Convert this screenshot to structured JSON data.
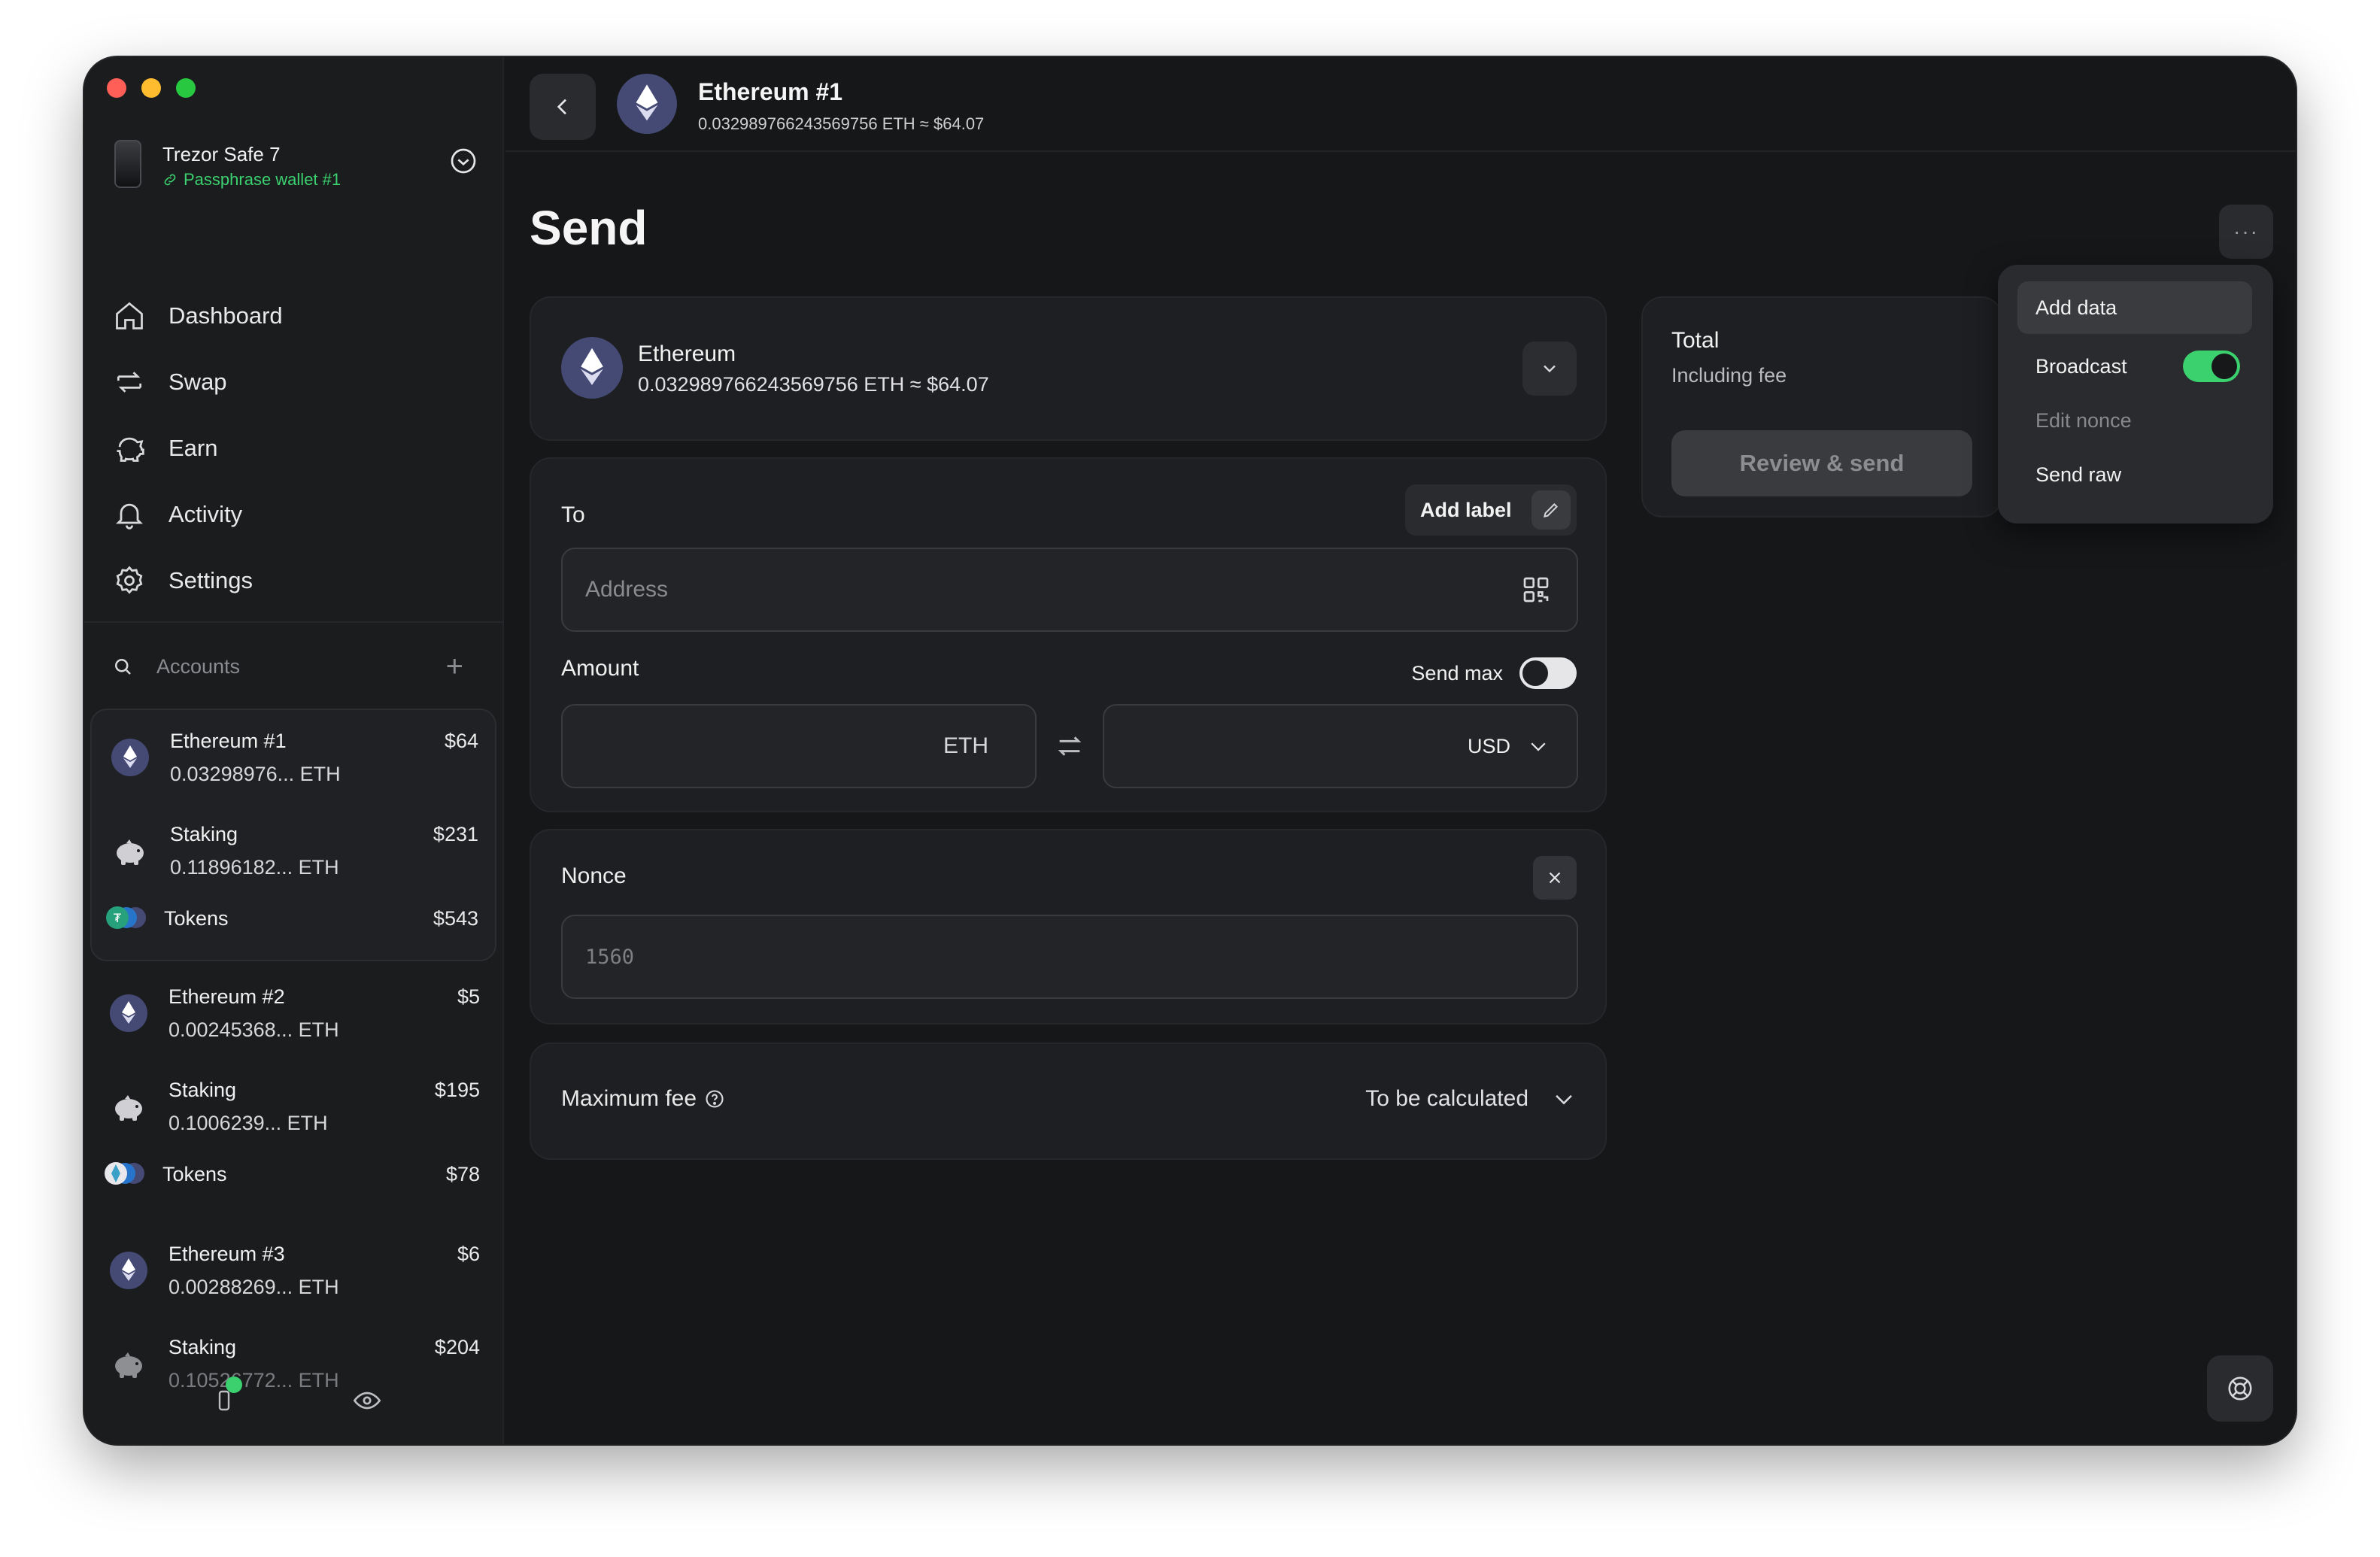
{
  "window": {
    "traffic_lights": [
      "close",
      "minimize",
      "zoom"
    ]
  },
  "device": {
    "name": "Trezor Safe 7",
    "passphrase": "Passphrase wallet #1"
  },
  "nav": [
    {
      "label": "Dashboard",
      "icon": "home-icon"
    },
    {
      "label": "Swap",
      "icon": "swap-icon"
    },
    {
      "label": "Earn",
      "icon": "piggy-bank-icon"
    },
    {
      "label": "Activity",
      "icon": "bell-icon"
    },
    {
      "label": "Settings",
      "icon": "gear-icon"
    }
  ],
  "accounts": {
    "label": "Accounts",
    "groups": [
      {
        "selected": true,
        "rows": [
          {
            "type": "eth",
            "name": "Ethereum #1",
            "balance": "0.03298976... ETH",
            "value": "$64"
          },
          {
            "type": "staking",
            "name": "Staking",
            "balance": "0.11896182... ETH",
            "value": "$231"
          },
          {
            "type": "tokens",
            "name": "Tokens",
            "value": "$543"
          }
        ]
      },
      {
        "selected": false,
        "rows": [
          {
            "type": "eth",
            "name": "Ethereum #2",
            "balance": "0.00245368... ETH",
            "value": "$5"
          },
          {
            "type": "staking",
            "name": "Staking",
            "balance": "0.1006239... ETH",
            "value": "$195"
          },
          {
            "type": "tokens",
            "name": "Tokens",
            "value": "$78"
          }
        ]
      },
      {
        "selected": false,
        "rows": [
          {
            "type": "eth",
            "name": "Ethereum #3",
            "balance": "0.00288269... ETH",
            "value": "$6"
          },
          {
            "type": "staking",
            "name": "Staking",
            "balance": "0.10526772... ETH",
            "value": "$204"
          }
        ]
      }
    ]
  },
  "topbar": {
    "account_name": "Ethereum #1",
    "balance": "0.032989766243569756 ETH ≈ $64.07"
  },
  "page": {
    "title": "Send",
    "more_label": "···"
  },
  "asset_card": {
    "name": "Ethereum",
    "balance": "0.032989766243569756 ETH ≈ $64.07"
  },
  "to": {
    "label": "To",
    "add_label": "Add label",
    "address_placeholder": "Address"
  },
  "amount": {
    "label": "Amount",
    "send_max_label": "Send max",
    "send_max_on": false,
    "crypto_unit": "ETH",
    "fiat_unit": "USD"
  },
  "nonce": {
    "label": "Nonce",
    "placeholder": "1560"
  },
  "fee": {
    "label": "Maximum fee",
    "value": "To be calculated"
  },
  "total": {
    "title": "Total",
    "subtitle": "Including fee",
    "review_button": "Review & send"
  },
  "menu": {
    "items": [
      {
        "label": "Add data",
        "highlighted": true
      },
      {
        "label": "Broadcast",
        "toggle": true,
        "toggle_on": true
      },
      {
        "label": "Edit nonce",
        "disabled": true
      },
      {
        "label": "Send raw"
      }
    ]
  },
  "colors": {
    "accent_green": "#3bd16f",
    "background": "#161719",
    "sidebar": "#1b1c1e",
    "card": "#1e1f22",
    "eth_purple": "#454a75"
  }
}
